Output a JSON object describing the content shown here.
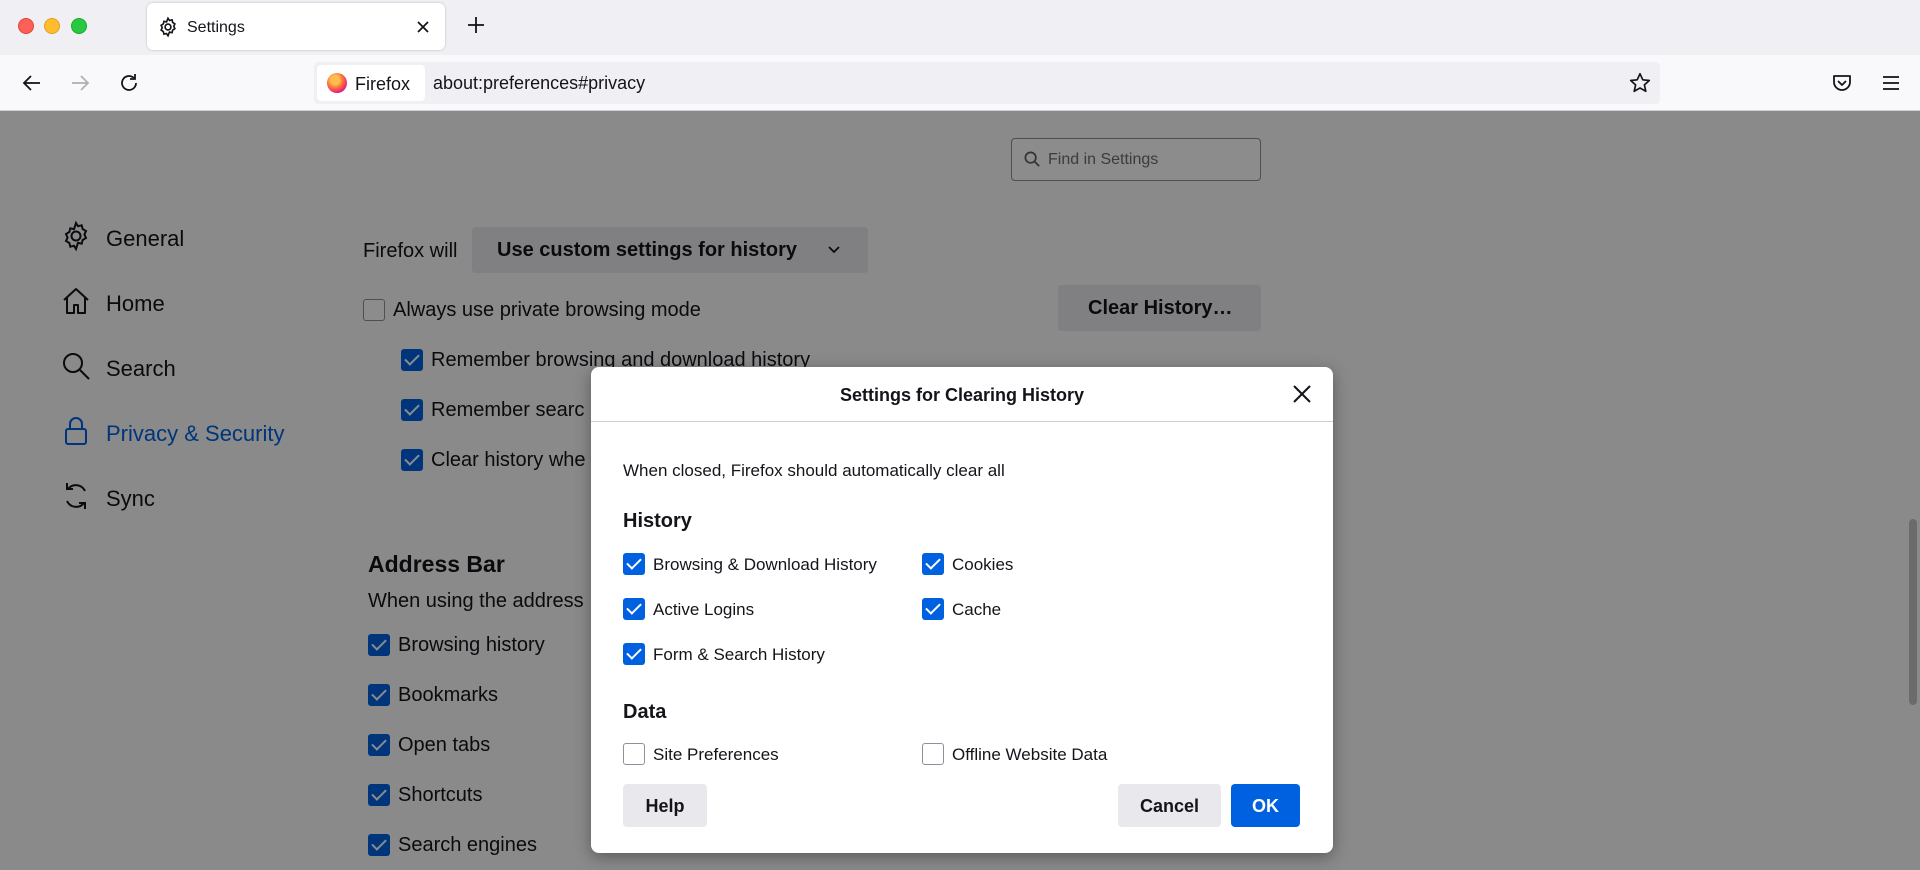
{
  "browser": {
    "tab_title": "Settings",
    "identity_label": "Firefox",
    "url": "about:preferences#privacy"
  },
  "search": {
    "placeholder": "Find in Settings"
  },
  "sidebar": {
    "items": [
      {
        "label": "General",
        "icon": "gear-icon"
      },
      {
        "label": "Home",
        "icon": "home-icon"
      },
      {
        "label": "Search",
        "icon": "search-icon"
      },
      {
        "label": "Privacy & Security",
        "icon": "lock-icon",
        "active": true
      },
      {
        "label": "Sync",
        "icon": "sync-icon"
      }
    ]
  },
  "history": {
    "prefix": "Firefox will",
    "mode": "Use custom settings for history",
    "private_mode": "Always use private browsing mode",
    "remember_browsing": "Remember browsing and download history",
    "remember_search": "Remember searc",
    "clear_on_close": "Clear history whe",
    "clear_button": "Clear History…"
  },
  "address_bar": {
    "heading": "Address Bar",
    "desc": "When using the address",
    "items": [
      "Browsing history",
      "Bookmarks",
      "Open tabs",
      "Shortcuts",
      "Search engines"
    ]
  },
  "dialog": {
    "title": "Settings for Clearing History",
    "description": "When closed, Firefox should automatically clear all",
    "history_heading": "History",
    "history_options": [
      {
        "label": "Browsing & Download History",
        "checked": true
      },
      {
        "label": "Cookies",
        "checked": true
      },
      {
        "label": "Active Logins",
        "checked": true
      },
      {
        "label": "Cache",
        "checked": true
      },
      {
        "label": "Form & Search History",
        "checked": true
      }
    ],
    "data_heading": "Data",
    "data_options": [
      {
        "label": "Site Preferences",
        "checked": false
      },
      {
        "label": "Offline Website Data",
        "checked": false
      }
    ],
    "help_label": "Help",
    "cancel_label": "Cancel",
    "ok_label": "OK"
  },
  "colors": {
    "accent": "#0061e0",
    "button_bg": "#e9e9ed"
  }
}
